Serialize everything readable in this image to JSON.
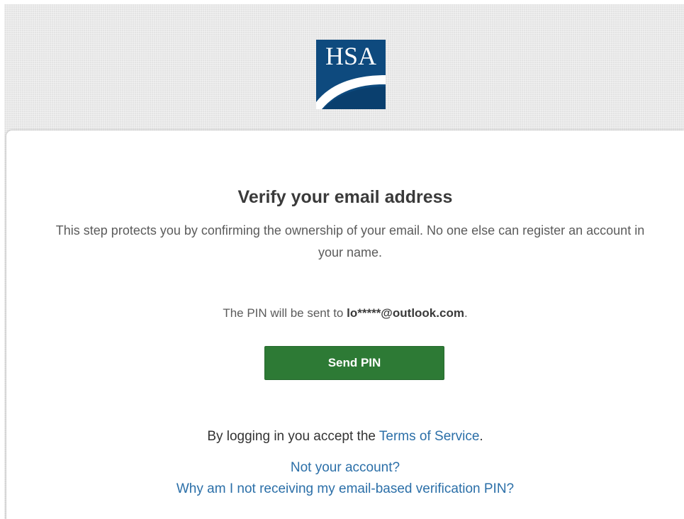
{
  "colors": {
    "background": "#e3e3e3",
    "card": "#ffffff",
    "logo_blue": "#0e4a7e",
    "button_green": "#2d7a35",
    "link_blue": "#2b6fa8",
    "text_dark": "#3a3a3a",
    "text_muted": "#5b5b5b"
  },
  "logo": {
    "text": "HSA",
    "icon": "hsa-logo"
  },
  "card": {
    "title": "Verify your email address",
    "description": "This step protects you by confirming the ownership of your email. No one else can register an account in your name.",
    "pin_prefix": "The PIN will be sent to ",
    "email": "lo*****@outlook.com",
    "pin_suffix": ".",
    "send_button": "Send PIN",
    "terms_prefix": "By logging in you accept the ",
    "terms_link": "Terms of Service",
    "terms_suffix": ".",
    "not_your_account": "Not your account?",
    "why_not_receiving": "Why am I not receiving my email-based verification PIN?"
  }
}
